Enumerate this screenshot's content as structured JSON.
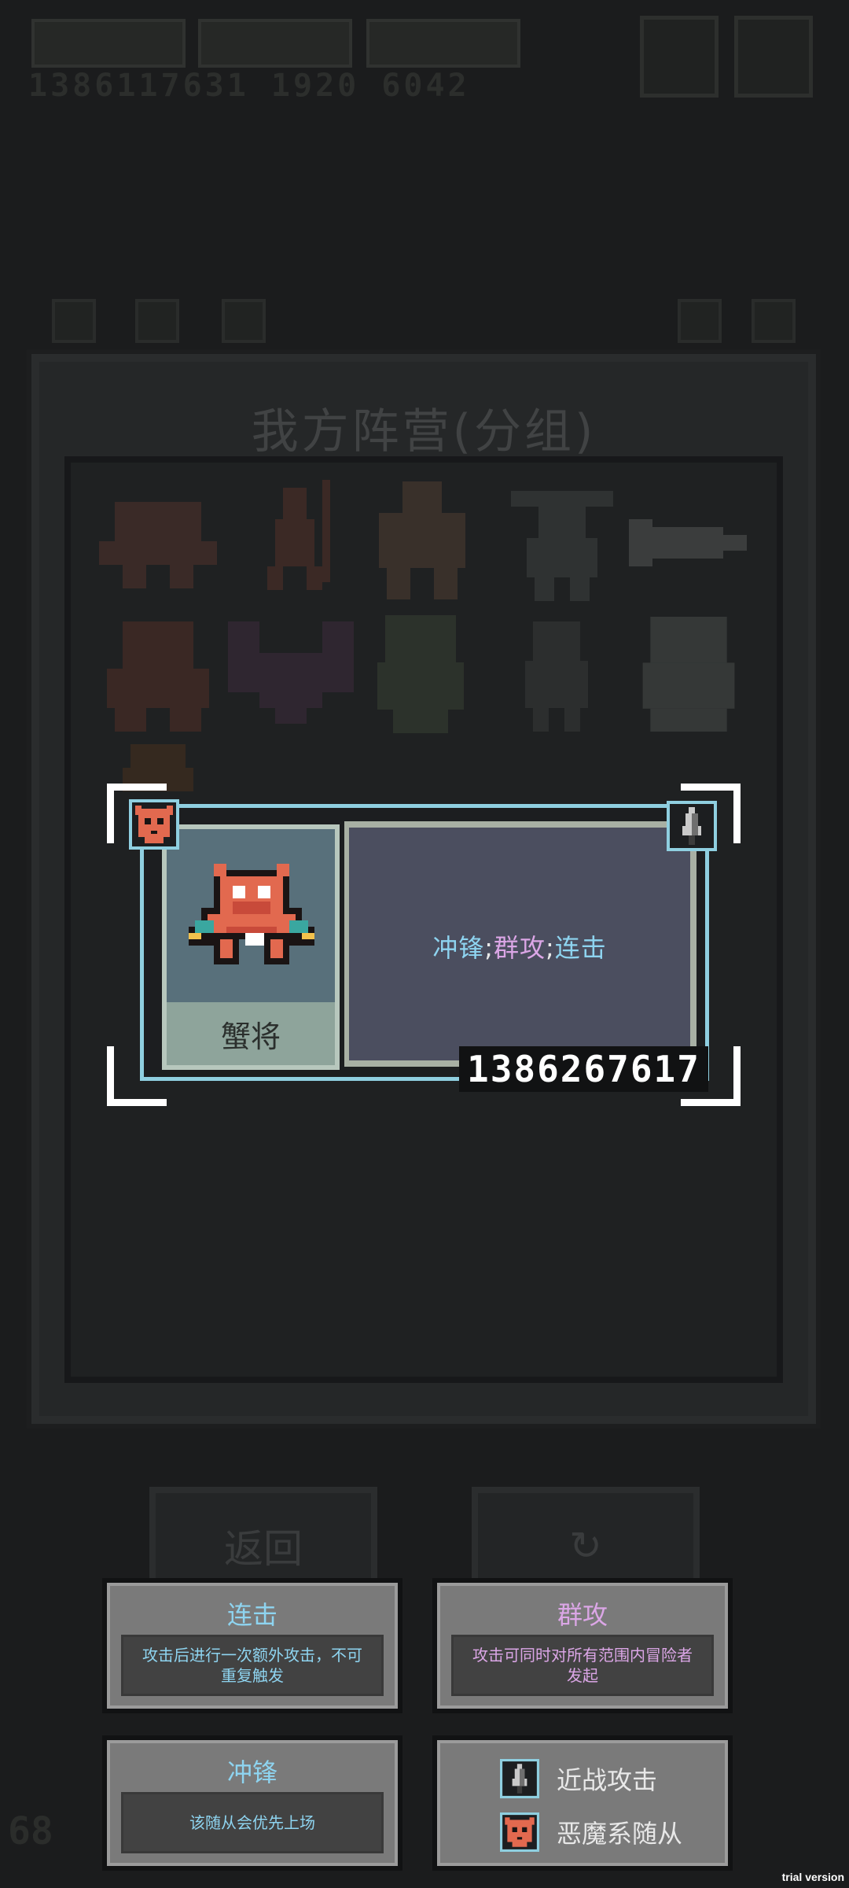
{
  "background": {
    "resource_number": "1386117631   1920   6042",
    "panel_title": "我方阵营(分组)",
    "back_button_label": "返回",
    "corner_number": "68"
  },
  "unit_card": {
    "name": "蟹将",
    "traits": {
      "charge": "冲锋",
      "aoe": "群攻",
      "combo": "连击",
      "separator": ";"
    },
    "id_number": "1386267617",
    "faction_badge_icon": "demon-mask-icon",
    "attack_type_icon": "melee-blade-icon"
  },
  "tooltips": {
    "combo": {
      "title": "连击",
      "description": "攻击后进行一次额外攻击，不可重复触发"
    },
    "aoe": {
      "title": "群攻",
      "description": "攻击可同时对所有范围内冒险者发起"
    },
    "charge": {
      "title": "冲锋",
      "description": "该随从会优先上场"
    },
    "legend": {
      "melee_label": "近战攻击",
      "demon_label": "恶魔系随从"
    }
  },
  "colors": {
    "trait_blue": "#8ed4f0",
    "trait_pink": "#dba6e6",
    "card_border": "#8fcfe0"
  },
  "watermark": "trial version"
}
